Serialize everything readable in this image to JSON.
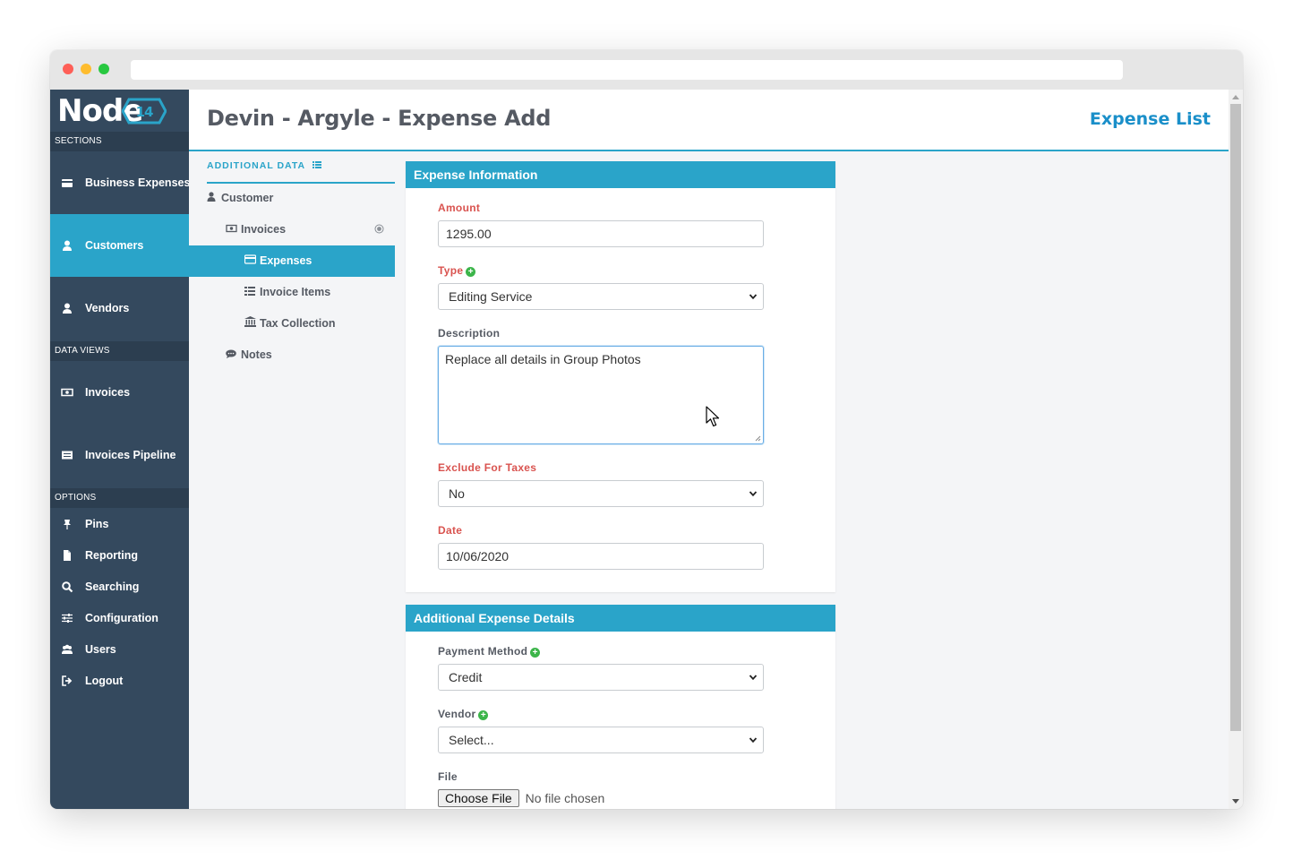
{
  "app": {
    "logo_text": "Node",
    "logo_badge": "14"
  },
  "sidebar": {
    "sections_label": "SECTIONS",
    "sections": [
      {
        "label": "Business Expenses",
        "icon": "credit-card-icon"
      },
      {
        "label": "Customers",
        "icon": "user-icon",
        "active": true
      },
      {
        "label": "Vendors",
        "icon": "user-icon"
      }
    ],
    "data_views_label": "DATA VIEWS",
    "data_views": [
      {
        "label": "Invoices",
        "icon": "money-icon"
      },
      {
        "label": "Invoices Pipeline",
        "icon": "list-alt-icon"
      }
    ],
    "options_label": "OPTIONS",
    "options": [
      {
        "label": "Pins",
        "icon": "pin-icon"
      },
      {
        "label": "Reporting",
        "icon": "file-icon"
      },
      {
        "label": "Searching",
        "icon": "search-icon"
      },
      {
        "label": "Configuration",
        "icon": "sliders-icon"
      },
      {
        "label": "Users",
        "icon": "users-icon"
      },
      {
        "label": "Logout",
        "icon": "sign-out-icon"
      }
    ]
  },
  "header": {
    "title": "Devin - Argyle - Expense Add",
    "expense_list_link": "Expense List"
  },
  "subnav": {
    "heading": "ADDITIONAL DATA",
    "items": [
      {
        "label": "Customer",
        "icon": "user-icon",
        "level": 0
      },
      {
        "label": "Invoices",
        "icon": "money-icon",
        "level": 1
      },
      {
        "label": "Expenses",
        "icon": "credit-card-icon",
        "level": 2,
        "active": true
      },
      {
        "label": "Invoice Items",
        "icon": "list-icon",
        "level": 2
      },
      {
        "label": "Tax Collection",
        "icon": "bank-icon",
        "level": 2
      },
      {
        "label": "Notes",
        "icon": "comment-icon",
        "level": 1
      }
    ]
  },
  "expense_info": {
    "heading": "Expense Information",
    "amount_label": "Amount",
    "amount_value": "1295.00",
    "type_label": "Type",
    "type_value": "Editing Service",
    "description_label": "Description",
    "description_value": "Replace all details in Group Photos",
    "exclude_label": "Exclude For Taxes",
    "exclude_value": "No",
    "date_label": "Date",
    "date_value": "10/06/2020"
  },
  "additional_details": {
    "heading": "Additional Expense Details",
    "payment_method_label": "Payment Method",
    "payment_method_value": "Credit",
    "vendor_label": "Vendor",
    "vendor_value": "Select...",
    "file_label": "File",
    "file_button": "Choose File",
    "file_status": "No file chosen"
  },
  "colors": {
    "sidebar_bg": "#34495e",
    "accent": "#2aa4c9",
    "required_label": "#d9534f",
    "link": "#1a8fc9"
  }
}
